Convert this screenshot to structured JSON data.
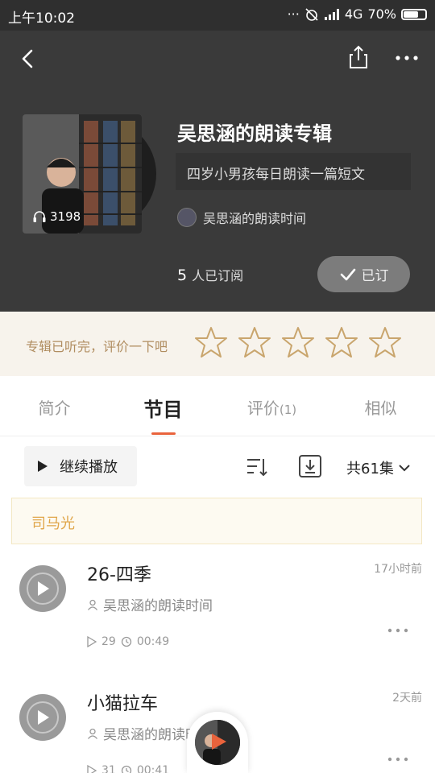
{
  "status_bar": {
    "time": "上午10:02",
    "network": "4G",
    "battery": "70%",
    "battery_level": 0.7
  },
  "header": {
    "album_title": "吴思涵的朗读专辑",
    "album_desc": "四岁小男孩每日朗读一篇短文",
    "play_count": "3198",
    "author": "吴思涵的朗读时间",
    "subscriber_count": "5",
    "subscriber_label": "人已订阅",
    "subscribe_label": "已订"
  },
  "rating": {
    "prompt": "专辑已听完，评价一下吧",
    "stars": 5
  },
  "tabs": [
    {
      "label": "简介",
      "count": ""
    },
    {
      "label": "节目",
      "count": ""
    },
    {
      "label": "评价",
      "count": "(1)"
    },
    {
      "label": "相似",
      "count": ""
    }
  ],
  "toolbar": {
    "continue_label": "继续播放",
    "episode_total": "共61集"
  },
  "notice": "司马光",
  "episodes": [
    {
      "title": "26-四季",
      "time_ago": "17小时前",
      "author": "吴思涵的朗读时间",
      "plays": "29",
      "duration": "00:49"
    },
    {
      "title": "小猫拉车",
      "time_ago": "2天前",
      "author": "吴思涵的朗读时间",
      "plays": "31",
      "duration": "00:41"
    }
  ],
  "colors": {
    "accent": "#e9633c",
    "header_bg": "#3a3a3a",
    "star": "#c9a56d",
    "notice_text": "#e0a64a"
  },
  "icons": {
    "back": "back-arrow-icon",
    "share": "share-icon",
    "more": "more-dots-icon",
    "headphones": "headphones-icon",
    "check": "check-icon",
    "star": "star-icon",
    "play": "play-icon",
    "sort": "sort-icon",
    "download": "download-icon",
    "chevron": "chevron-down-icon",
    "person": "person-icon",
    "clock": "clock-icon"
  }
}
